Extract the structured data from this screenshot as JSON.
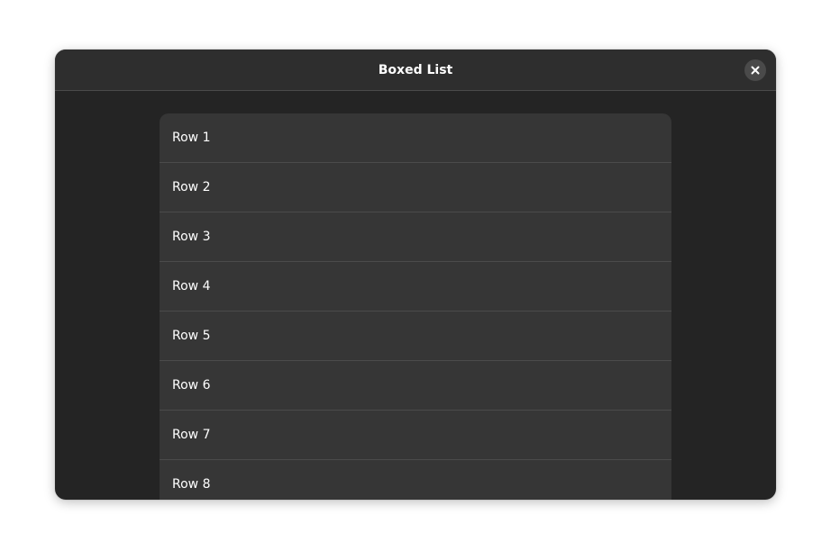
{
  "window": {
    "title": "Boxed List"
  },
  "header": {
    "close_icon": "close-icon"
  },
  "list": {
    "rows": [
      {
        "label": "Row 1"
      },
      {
        "label": "Row 2"
      },
      {
        "label": "Row 3"
      },
      {
        "label": "Row 4"
      },
      {
        "label": "Row 5"
      },
      {
        "label": "Row 6"
      },
      {
        "label": "Row 7"
      },
      {
        "label": "Row 8"
      }
    ]
  },
  "colors": {
    "window_bg": "#242424",
    "headerbar_bg": "#2e2e2e",
    "row_bg": "#363636",
    "text": "#ffffff"
  }
}
